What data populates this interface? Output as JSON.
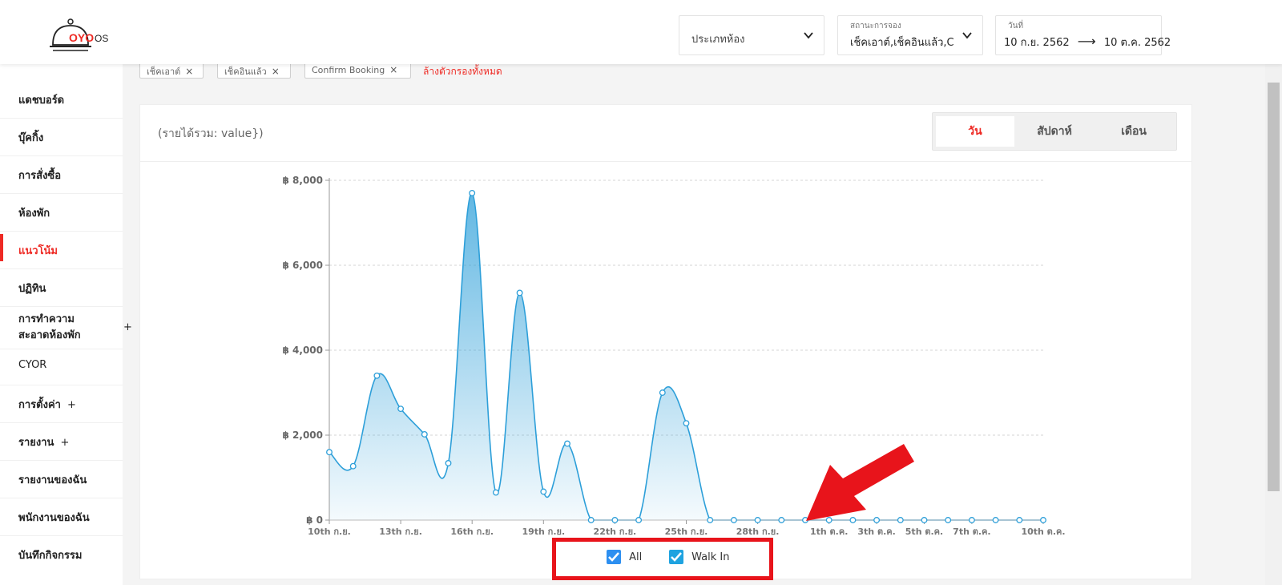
{
  "header": {
    "logo_brand": "OYO",
    "logo_suffix": "OS",
    "room_type": {
      "placeholder": "ประเภทห้อง"
    },
    "booking_status": {
      "label": "สถานะการจอง",
      "value": "เช็คเอาต์,เช็คอินแล้ว,C"
    },
    "date": {
      "label": "วันที่",
      "from": "10 ก.ย. 2562",
      "arrow": "⟶",
      "to": "10 ต.ค. 2562"
    }
  },
  "sidebar": {
    "items": [
      {
        "label": "แดชบอร์ด"
      },
      {
        "label": "บุ๊คกิ้ง"
      },
      {
        "label": "การสั่งซื้อ"
      },
      {
        "label": "ห้องพัก"
      },
      {
        "label": "แนวโน้ม",
        "active": true
      },
      {
        "label": "ปฏิทิน"
      },
      {
        "label": "การทำความ",
        "label2": "สะอาดห้องพัก",
        "expand": "+"
      },
      {
        "label": "CYOR"
      },
      {
        "label": "การตั้งค่า",
        "expand": "+"
      },
      {
        "label": "รายงาน",
        "expand": "+"
      },
      {
        "label": "รายงานของฉัน"
      },
      {
        "label": "พนักงานของฉัน"
      },
      {
        "label": "บันทึกกิจกรรม"
      }
    ]
  },
  "filters": {
    "chips": [
      {
        "label": "เช็คเอาต์",
        "remove": "×"
      },
      {
        "label": "เช็คอินแล้ว",
        "remove": "×"
      },
      {
        "label": "Confirm Booking",
        "remove": "×"
      }
    ],
    "clear_all": "ล้างตัวกรองทั้งหมด"
  },
  "card": {
    "revenue_text": "(รายได้รวม: value})",
    "period_tabs": [
      {
        "label": "วัน",
        "active": true
      },
      {
        "label": "สัปดาห์",
        "active": false
      },
      {
        "label": "เดือน",
        "active": false
      }
    ]
  },
  "legend": {
    "items": [
      {
        "label": "All",
        "checked": true
      },
      {
        "label": "Walk In",
        "checked": true
      }
    ]
  },
  "colors": {
    "accent_red": "#ee2a24",
    "line_blue": "#2d9fd9",
    "checkbox_blue": "#2d8ff0",
    "callout_red": "#e8141b"
  },
  "chart_data": {
    "type": "area",
    "ylim": [
      0,
      8000
    ],
    "y_ticks": [
      "฿ 0",
      "฿ 2,000",
      "฿ 4,000",
      "฿ 6,000",
      "฿ 8,000"
    ],
    "y_tick_values": [
      0,
      2000,
      4000,
      6000,
      8000
    ],
    "x_tick_labels": [
      {
        "label": "10th ก.ย.",
        "index": 0
      },
      {
        "label": "13th ก.ย.",
        "index": 3
      },
      {
        "label": "16th ก.ย.",
        "index": 6
      },
      {
        "label": "19th ก.ย.",
        "index": 9
      },
      {
        "label": "22th ก.ย.",
        "index": 12
      },
      {
        "label": "25th ก.ย.",
        "index": 15
      },
      {
        "label": "28th ก.ย.",
        "index": 18
      },
      {
        "label": "1th ต.ค.",
        "index": 21
      },
      {
        "label": "3th ต.ค.",
        "index": 23
      },
      {
        "label": "5th ต.ค.",
        "index": 25
      },
      {
        "label": "7th ต.ค.",
        "index": 27
      },
      {
        "label": "10th ต.ค.",
        "index": 30
      }
    ],
    "series": [
      {
        "values": [
          1600,
          1270,
          3400,
          2620,
          2020,
          1340,
          7700,
          650,
          5350,
          670,
          1800,
          0,
          0,
          0,
          3000,
          2280,
          0,
          0,
          0,
          0,
          0,
          0,
          0,
          0,
          0,
          0,
          0,
          0,
          0,
          0,
          0
        ]
      }
    ],
    "grid": true
  }
}
